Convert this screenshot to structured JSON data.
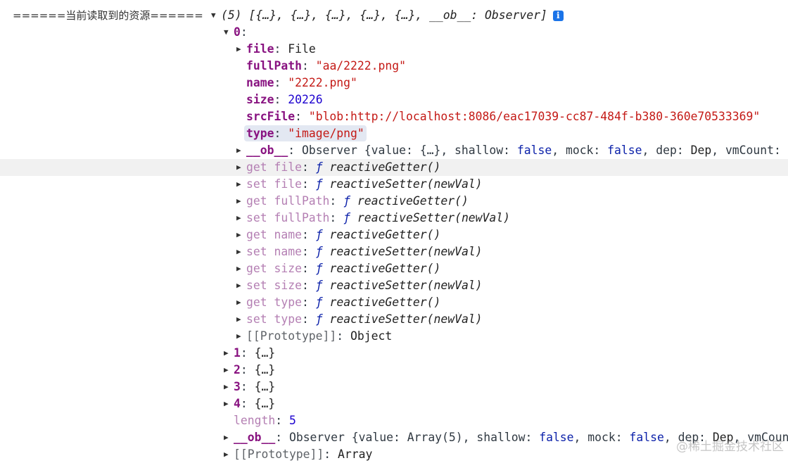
{
  "console": {
    "log_label": "======当前读取到的资源======",
    "info_icon": "i",
    "watermark": "@稀土掘金技术社区",
    "rows": [
      {
        "indent": 0,
        "arrow": "down",
        "parts": [
          [
            "(5) ",
            "it"
          ],
          [
            "[{…}, {…}, {…}, {…}, {…}, __ob__: Observer]",
            "it"
          ]
        ],
        "info": true
      },
      {
        "indent": 1,
        "arrow": "down",
        "parts": [
          [
            "0",
            "key"
          ],
          [
            ":",
            "plain"
          ]
        ]
      },
      {
        "indent": 2,
        "arrow": "right",
        "parts": [
          [
            "file",
            "key"
          ],
          [
            ": ",
            "plain"
          ],
          [
            "File",
            "dark"
          ]
        ]
      },
      {
        "indent": 2,
        "parts": [
          [
            "fullPath",
            "key"
          ],
          [
            ": ",
            "plain"
          ],
          [
            "\"aa/2222.png\"",
            "str"
          ]
        ]
      },
      {
        "indent": 2,
        "parts": [
          [
            "name",
            "key"
          ],
          [
            ": ",
            "plain"
          ],
          [
            "\"2222.png\"",
            "str"
          ]
        ]
      },
      {
        "indent": 2,
        "parts": [
          [
            "size",
            "key"
          ],
          [
            ": ",
            "plain"
          ],
          [
            "20226",
            "num"
          ]
        ]
      },
      {
        "indent": 2,
        "parts": [
          [
            "srcFile",
            "key"
          ],
          [
            ": ",
            "plain"
          ],
          [
            "\"blob:http://localhost:8086/eac17039-cc87-484f-b380-360e70533369\"",
            "str"
          ]
        ]
      },
      {
        "indent": 2,
        "highlight": true,
        "parts": [
          [
            "type",
            "key"
          ],
          [
            ": ",
            "plain"
          ],
          [
            "\"image/png\"",
            "str"
          ]
        ]
      },
      {
        "indent": 2,
        "arrow": "right",
        "parts": [
          [
            "__ob__",
            "key"
          ],
          [
            ": Observer {value: {…}, shallow: ",
            "plain"
          ],
          [
            "false",
            "bool"
          ],
          [
            ", mock: ",
            "plain"
          ],
          [
            "false",
            "bool"
          ],
          [
            ", dep: ",
            "plain"
          ],
          [
            "Dep",
            "dark"
          ],
          [
            ", vmCount: ",
            "plain"
          ]
        ]
      },
      {
        "indent": 2,
        "arrow": "right",
        "hover": true,
        "parts": [
          [
            "get file",
            "keyd"
          ],
          [
            ": ",
            "plain"
          ],
          [
            "ƒ ",
            "fnf"
          ],
          [
            "reactiveGetter()",
            "it"
          ]
        ]
      },
      {
        "indent": 2,
        "arrow": "right",
        "parts": [
          [
            "set file",
            "keyd"
          ],
          [
            ": ",
            "plain"
          ],
          [
            "ƒ ",
            "fnf"
          ],
          [
            "reactiveSetter(newVal)",
            "it"
          ]
        ]
      },
      {
        "indent": 2,
        "arrow": "right",
        "parts": [
          [
            "get fullPath",
            "keyd"
          ],
          [
            ": ",
            "plain"
          ],
          [
            "ƒ ",
            "fnf"
          ],
          [
            "reactiveGetter()",
            "it"
          ]
        ]
      },
      {
        "indent": 2,
        "arrow": "right",
        "parts": [
          [
            "set fullPath",
            "keyd"
          ],
          [
            ": ",
            "plain"
          ],
          [
            "ƒ ",
            "fnf"
          ],
          [
            "reactiveSetter(newVal)",
            "it"
          ]
        ]
      },
      {
        "indent": 2,
        "arrow": "right",
        "parts": [
          [
            "get name",
            "keyd"
          ],
          [
            ": ",
            "plain"
          ],
          [
            "ƒ ",
            "fnf"
          ],
          [
            "reactiveGetter()",
            "it"
          ]
        ]
      },
      {
        "indent": 2,
        "arrow": "right",
        "parts": [
          [
            "set name",
            "keyd"
          ],
          [
            ": ",
            "plain"
          ],
          [
            "ƒ ",
            "fnf"
          ],
          [
            "reactiveSetter(newVal)",
            "it"
          ]
        ]
      },
      {
        "indent": 2,
        "arrow": "right",
        "parts": [
          [
            "get size",
            "keyd"
          ],
          [
            ": ",
            "plain"
          ],
          [
            "ƒ ",
            "fnf"
          ],
          [
            "reactiveGetter()",
            "it"
          ]
        ]
      },
      {
        "indent": 2,
        "arrow": "right",
        "parts": [
          [
            "set size",
            "keyd"
          ],
          [
            ": ",
            "plain"
          ],
          [
            "ƒ ",
            "fnf"
          ],
          [
            "reactiveSetter(newVal)",
            "it"
          ]
        ]
      },
      {
        "indent": 2,
        "arrow": "right",
        "parts": [
          [
            "get type",
            "keyd"
          ],
          [
            ": ",
            "plain"
          ],
          [
            "ƒ ",
            "fnf"
          ],
          [
            "reactiveGetter()",
            "it"
          ]
        ]
      },
      {
        "indent": 2,
        "arrow": "right",
        "parts": [
          [
            "set type",
            "keyd"
          ],
          [
            ": ",
            "plain"
          ],
          [
            "ƒ ",
            "fnf"
          ],
          [
            "reactiveSetter(newVal)",
            "it"
          ]
        ]
      },
      {
        "indent": 2,
        "arrow": "right",
        "parts": [
          [
            "[[Prototype]]",
            "proto"
          ],
          [
            ": ",
            "plain"
          ],
          [
            "Object",
            "dark"
          ]
        ]
      },
      {
        "indent": 1,
        "arrow": "right",
        "parts": [
          [
            "1",
            "key"
          ],
          [
            ": ",
            "plain"
          ],
          [
            "{…}",
            "dark"
          ]
        ]
      },
      {
        "indent": 1,
        "arrow": "right",
        "parts": [
          [
            "2",
            "key"
          ],
          [
            ": ",
            "plain"
          ],
          [
            "{…}",
            "dark"
          ]
        ]
      },
      {
        "indent": 1,
        "arrow": "right",
        "parts": [
          [
            "3",
            "key"
          ],
          [
            ": ",
            "plain"
          ],
          [
            "{…}",
            "dark"
          ]
        ]
      },
      {
        "indent": 1,
        "arrow": "right",
        "parts": [
          [
            "4",
            "key"
          ],
          [
            ": ",
            "plain"
          ],
          [
            "{…}",
            "dark"
          ]
        ]
      },
      {
        "indent": 1,
        "parts": [
          [
            "length",
            "keyd"
          ],
          [
            ": ",
            "plain"
          ],
          [
            "5",
            "num"
          ]
        ]
      },
      {
        "indent": 1,
        "arrow": "right",
        "parts": [
          [
            "__ob__",
            "key"
          ],
          [
            ": Observer {value: Array(5), shallow: ",
            "plain"
          ],
          [
            "false",
            "bool"
          ],
          [
            ", mock: ",
            "plain"
          ],
          [
            "false",
            "bool"
          ],
          [
            ", dep: ",
            "plain"
          ],
          [
            "Dep",
            "dark"
          ],
          [
            ", vmCount",
            "plain"
          ]
        ]
      },
      {
        "indent": 1,
        "arrow": "right",
        "parts": [
          [
            "[[Prototype]]",
            "proto"
          ],
          [
            ": ",
            "plain"
          ],
          [
            "Array",
            "dark"
          ]
        ]
      }
    ]
  }
}
